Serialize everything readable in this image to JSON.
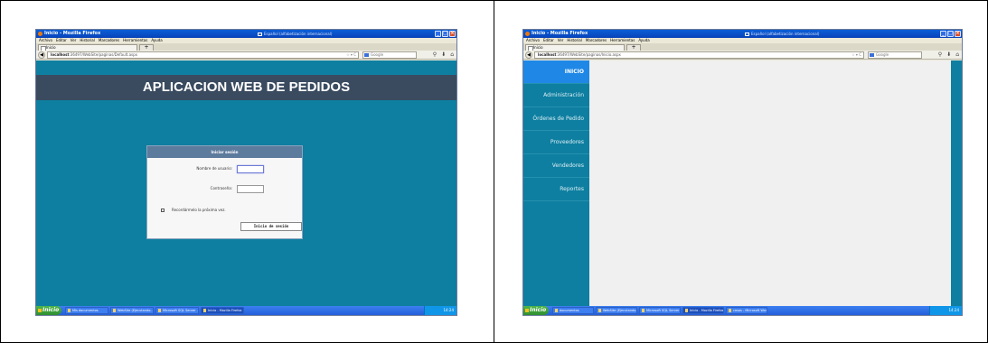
{
  "left": {
    "browser": {
      "title": "Inicio - Mozilla Firefox",
      "language": "Español (alfabetización internacional)",
      "menu": [
        "Archivo",
        "Editar",
        "Ver",
        "Historial",
        "Marcadores",
        "Herramientas",
        "Ayuda"
      ],
      "tab_label": "Inicio",
      "new_tab": "+",
      "url_host": "localhost",
      "url_path": ":36497/WebSite/paginas/Default.aspx",
      "search_engine": "Google"
    },
    "page": {
      "app_title": "APLICACION WEB DE PEDIDOS",
      "login": {
        "title": "Iniciar sesión",
        "username_label": "Nombre de usuario:",
        "password_label": "Contraseña:",
        "remember_label": "Recordármelo la próxima vez.",
        "submit_label": "Inicio de sesión"
      }
    },
    "taskbar": {
      "start": "Inicio",
      "tasks": [
        "Mis documentos",
        "WebSite (Ejecutando...",
        "Microsoft SQL Server ...",
        "Inicio - Mozilla Firefox"
      ],
      "clock": "14:24"
    }
  },
  "right": {
    "browser": {
      "title": "Inicio - Mozilla Firefox",
      "language": "Español (alfabetización internacional)",
      "menu": [
        "Archivo",
        "Editar",
        "Ver",
        "Historial",
        "Marcadores",
        "Herramientas",
        "Ayuda"
      ],
      "tab_label": "Inicio",
      "new_tab": "+",
      "url_host": "localhost",
      "url_path": ":36497/WebSite/paginas/Inicio.aspx",
      "search_engine": "Google"
    },
    "sidebar": {
      "items": [
        "INICIO",
        "Administración",
        "Órdenes de Pedido",
        "Proveedores",
        "Vendedores",
        "Reportes"
      ]
    },
    "taskbar": {
      "start": "Inicio",
      "tasks": [
        "documentos",
        "WebSite (Ejecutando...",
        "Microsoft SQL Server ...",
        "Inicio - Mozilla Firefox",
        "casos - Microsoft Word"
      ],
      "clock": "14:24"
    }
  }
}
